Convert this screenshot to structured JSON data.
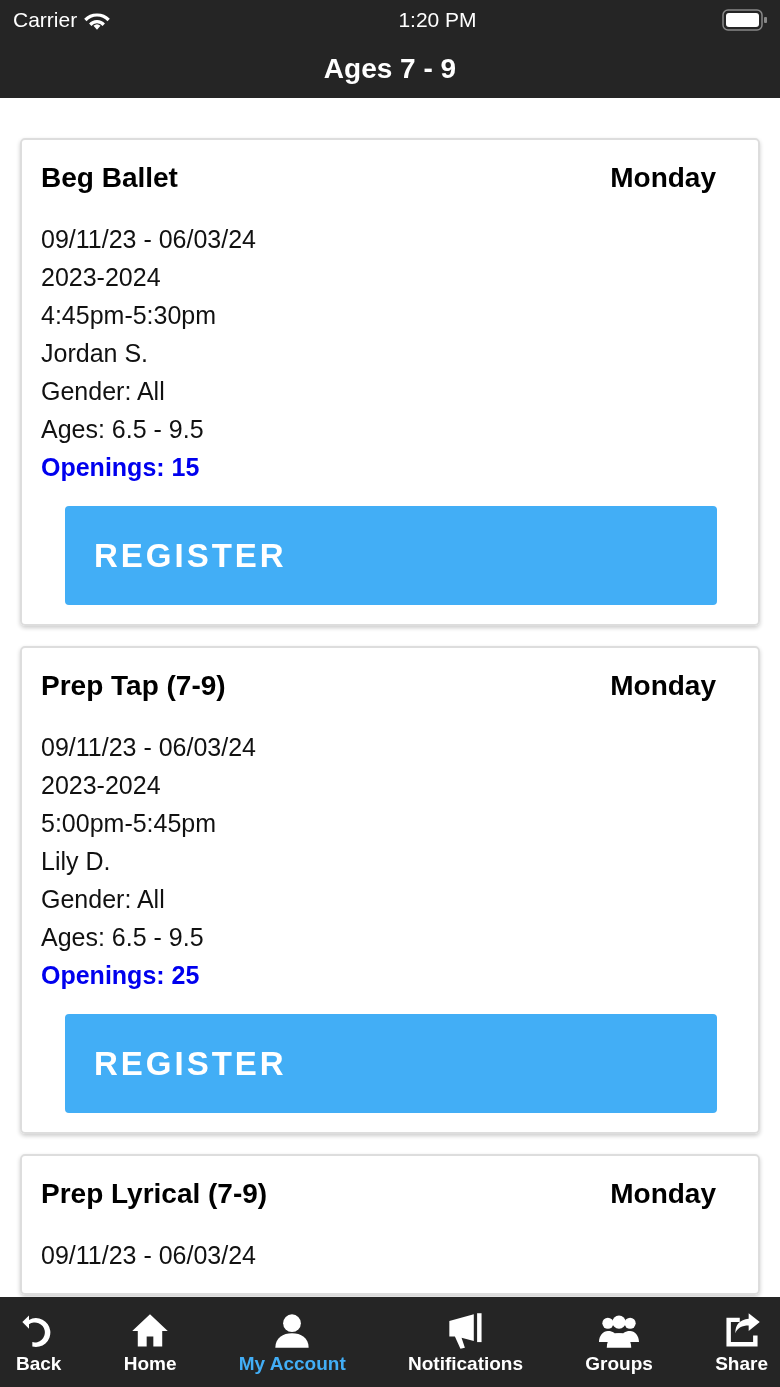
{
  "status_bar": {
    "carrier": "Carrier",
    "time": "1:20 PM"
  },
  "nav_bar": {
    "title": "Ages 7 - 9"
  },
  "classes": [
    {
      "name": "Beg Ballet",
      "day": "Monday",
      "details": [
        "09/11/23 - 06/03/24",
        "2023-2024",
        "4:45pm-5:30pm",
        "Jordan S.",
        "Gender: All",
        "Ages: 6.5 - 9.5"
      ],
      "openings": "Openings: 15",
      "button": "REGISTER"
    },
    {
      "name": "Prep Tap (7-9)",
      "day": "Monday",
      "details": [
        "09/11/23 - 06/03/24",
        "2023-2024",
        "5:00pm-5:45pm",
        "Lily D.",
        "Gender: All",
        "Ages: 6.5 - 9.5"
      ],
      "openings": "Openings: 25",
      "button": "REGISTER"
    },
    {
      "name": "Prep Lyrical (7-9)",
      "day": "Monday",
      "details": [
        "09/11/23 - 06/03/24"
      ]
    }
  ],
  "tab_bar": [
    {
      "label": "Back",
      "selected": false
    },
    {
      "label": "Home",
      "selected": false
    },
    {
      "label": "My Account",
      "selected": true
    },
    {
      "label": "Notifications",
      "selected": false
    },
    {
      "label": "Groups",
      "selected": false
    },
    {
      "label": "Share",
      "selected": false
    }
  ]
}
